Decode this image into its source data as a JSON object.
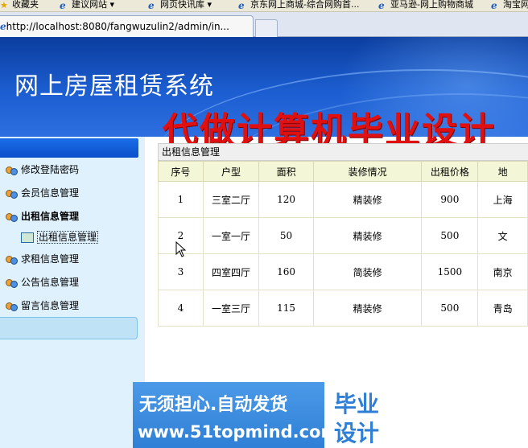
{
  "browser": {
    "favorites": [
      {
        "label": "收藏夹",
        "icon": "star-icon"
      },
      {
        "label": "建议网站 ▾",
        "icon": "ie-page-icon"
      },
      {
        "label": "网页快讯库 ▾",
        "icon": "ie-page-icon"
      },
      {
        "label": "京东网上商城-综合网购首...",
        "icon": "ie-page-icon"
      },
      {
        "label": "亚马逊-网上购物商城",
        "icon": "ie-page-icon"
      },
      {
        "label": "淘宝网",
        "icon": "ie-page-icon"
      }
    ],
    "tab_url": "http://localhost:8080/fangwuzulin2/admin/in..."
  },
  "header": {
    "title": "网上房屋租赁系统",
    "watermark": "代做计算机毕业设计"
  },
  "sidebar": {
    "items": [
      {
        "label": "修改登陆密码"
      },
      {
        "label": "会员信息管理"
      },
      {
        "label": "出租信息管理"
      },
      {
        "label": "求租信息管理"
      },
      {
        "label": "公告信息管理"
      },
      {
        "label": "留言信息管理"
      }
    ],
    "sub_item": "出租信息管理"
  },
  "main": {
    "panel_title": "出租信息管理",
    "columns": [
      "序号",
      "户型",
      "面积",
      "装修情况",
      "出租价格",
      "地"
    ],
    "rows": [
      [
        "1",
        "三室二厅",
        "120",
        "精装修",
        "900",
        "上海"
      ],
      [
        "2",
        "一室一厅",
        "50",
        "精装修",
        "500",
        "文"
      ],
      [
        "3",
        "四室四厅",
        "160",
        "简装修",
        "1500",
        "南京"
      ],
      [
        "4",
        "一室三厅",
        "115",
        "精装修",
        "500",
        "青岛"
      ]
    ]
  },
  "ad": {
    "line1": "无须担心.自动发货",
    "line2": "www.51topmind.com",
    "badge_top": "毕业",
    "badge_bottom": "设计"
  },
  "colors": {
    "banner": "#1c5ed1",
    "sidebar_bg": "#dff1fc",
    "watermark": "#e11010",
    "table_header": "#f4f7d7"
  }
}
